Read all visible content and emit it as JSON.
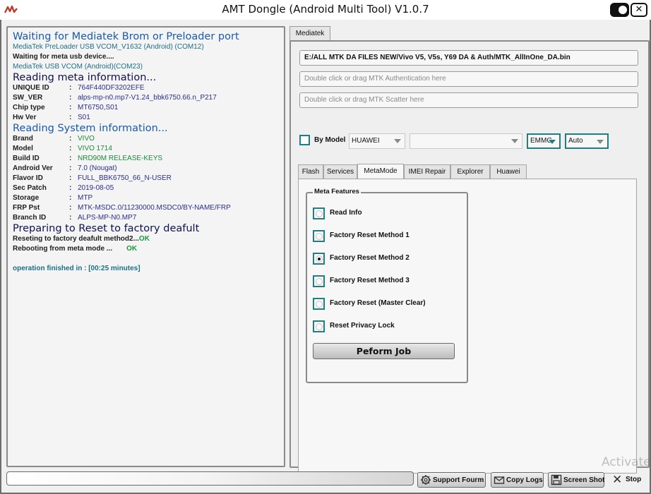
{
  "window": {
    "title": "AMT Dongle (Android Multi Tool) V1.0.7"
  },
  "log": {
    "lines": {
      "l1": "Waiting for Mediatek Brom or Preloader port",
      "l2": "MediaTek PreLoader USB VCOM_V1632 (Android) (COM12)",
      "l3": "Waiting for meta usb device....",
      "l4": "MediaTek USB VCOM (Android)(COM23)",
      "l5": "Reading meta information...",
      "l6": "Reading System information...",
      "l7": "Preparing to Reset to factory deafult",
      "l8_text": "Reseting to factory deafult method2...",
      "l8_ok": "OK",
      "l9_text": "Rebooting from meta mode ...",
      "l9_ok": "OK",
      "l10": "operation finished in : [00:25 minutes]"
    },
    "separator": ":",
    "meta_info": [
      {
        "key": "UNIQUE ID",
        "value": "764F440DF3202EFE"
      },
      {
        "key": "SW_VER",
        "value": "alps-mp-n0.mp7-V1.24_bbk6750.66.n_P217"
      },
      {
        "key": "Chip type",
        "value": "MT6750,S01"
      },
      {
        "key": "Hw Ver",
        "value": "S01"
      }
    ],
    "system_info": [
      {
        "key": "Brand",
        "value": "VIVO"
      },
      {
        "key": "Model",
        "value": "VIVO 1714"
      },
      {
        "key": "Build ID",
        "value": "NRD90M RELEASE-KEYS"
      },
      {
        "key": "Android Ver",
        "value": "7.0 (Nougat)"
      },
      {
        "key": "Flavor ID",
        "value": "FULL_BBK6750_66_N-USER"
      },
      {
        "key": "Sec Patch",
        "value": "2019-08-05"
      },
      {
        "key": "Storage",
        "value": "MTP"
      },
      {
        "key": "FRP Pst",
        "value": "MTK-MSDC.0/11230000.MSDC0/BY-NAME/FRP"
      },
      {
        "key": "Branch ID",
        "value": "ALPS-MP-N0.MP7"
      }
    ]
  },
  "right": {
    "main_tab": "Mediatek",
    "da_file": "E:/ALL  MTK DA FILES NEW/Vivo V5, V5s, Y69 DA & Auth/MTK_AllInOne_DA.bin",
    "auth_placeholder": "Double click or drag MTK Authentication here",
    "scatter_placeholder": "Double click or drag MTK Scatter here",
    "by_model_label": "By Model",
    "brand_value": "HUAWEI",
    "model_value": "",
    "storage_value": "EMMC",
    "mode_value": "Auto",
    "sub_tabs": [
      "Flash",
      "Services",
      "MetaMode",
      "IMEI Repair",
      "Explorer",
      "Huawei"
    ],
    "meta_features_title": "Meta Features",
    "options": [
      "Read Info",
      "Factory Reset Method 1",
      "Factory Reset Method 2",
      "Factory Reset Method 3",
      "Factory Reset (Master Clear)",
      "Reset Privacy Lock"
    ],
    "selected_option": "Factory Reset Method 2",
    "perform_label": "Peform Job"
  },
  "bottom": {
    "support_label": "Support Fourm",
    "copy_logs_label": "Copy Logs",
    "screenshot_label": "Screen Shot",
    "stop_label": "Stop",
    "watermark": "Activate"
  },
  "colors": {
    "accent_teal": "#1e7f80",
    "log_blue": "#1b5aa6",
    "log_navy": "#2a2f8c",
    "ok_green": "#1b9a3a"
  }
}
